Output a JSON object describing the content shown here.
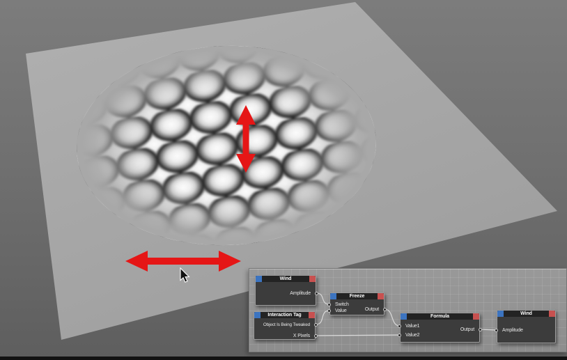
{
  "viewport": {
    "description": "3D view with deformed plane (wave ripples)",
    "manipulators": {
      "vertical_arrow": "amplitude-axis handle",
      "horizontal_arrow": "x-axis handle",
      "arrow_color": "#e51616"
    }
  },
  "colors": {
    "background_top": "#7c7c7c",
    "background_bottom": "#5e5e5e",
    "plane": "#a8a8a8",
    "panel": "#939393",
    "node_body": "#3c3c3c",
    "node_titlebar": "#232323",
    "node_chip_blue": "#3c74c0",
    "node_chip_red": "#c85150",
    "wire": "#d8d8d8",
    "arrow_red": "#e51616"
  },
  "nodes": [
    {
      "title": "Wind",
      "outputs": [
        {
          "label": "Amplitude"
        }
      ],
      "inputs": []
    },
    {
      "title": "Freeze",
      "inputs": [
        {
          "label": "Switch"
        },
        {
          "label": "Value"
        }
      ],
      "outputs": [
        {
          "label": "Output"
        }
      ]
    },
    {
      "title": "Interaction Tag",
      "outputs": [
        {
          "label": "Object Is Being Tweaked"
        },
        {
          "label": "X Pixels"
        }
      ],
      "inputs": []
    },
    {
      "title": "Formula",
      "inputs": [
        {
          "label": "Value1"
        },
        {
          "label": "Value2"
        }
      ],
      "outputs": [
        {
          "label": "Output"
        }
      ]
    },
    {
      "title": "Wind",
      "inputs": [
        {
          "label": "Amplitude"
        }
      ],
      "outputs": []
    }
  ]
}
